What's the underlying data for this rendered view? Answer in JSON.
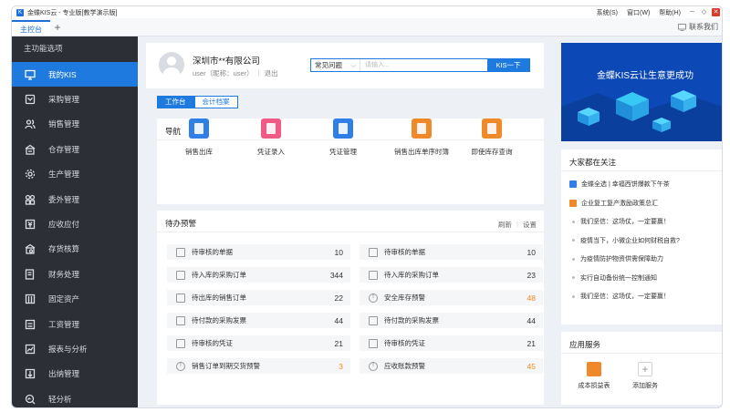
{
  "window": {
    "title": "金蝶KIS云 - 专业版[教学演示版]",
    "menu": [
      "系统(S)",
      "窗口(W)",
      "帮助(H)"
    ],
    "min": "－",
    "restore": "◇",
    "close": "✕"
  },
  "tabs": {
    "main": "主控台",
    "add": "+",
    "contact": "联系我们"
  },
  "sidebar": {
    "header": "主功能选项",
    "items": [
      {
        "label": "我的KIS",
        "icon": "monitor-icon"
      },
      {
        "label": "采购管理",
        "icon": "cart-icon"
      },
      {
        "label": "销售管理",
        "icon": "people-icon"
      },
      {
        "label": "仓存管理",
        "icon": "warehouse-icon"
      },
      {
        "label": "生产管理",
        "icon": "gear-icon"
      },
      {
        "label": "委外管理",
        "icon": "grid-icon"
      },
      {
        "label": "应收应付",
        "icon": "yuan-icon"
      },
      {
        "label": "存货核算",
        "icon": "inventory-icon"
      },
      {
        "label": "财务处理",
        "icon": "ledger-icon"
      },
      {
        "label": "固定资产",
        "icon": "asset-icon"
      },
      {
        "label": "工资管理",
        "icon": "payroll-icon"
      },
      {
        "label": "报表与分析",
        "icon": "chart-icon"
      },
      {
        "label": "出纳管理",
        "icon": "cash-icon"
      },
      {
        "label": "轻分析",
        "icon": "analysis-icon"
      }
    ]
  },
  "company": {
    "name": "深圳市**有限公司",
    "user": "user（昵称：user）",
    "logout": "退出"
  },
  "search": {
    "category": "常见问题",
    "placeholder": "请输入...",
    "button": "KIS一下"
  },
  "subtabs": [
    "工作台",
    "会计档案"
  ],
  "nav": {
    "title": "导航",
    "items": [
      {
        "label": "销售出库",
        "color": "#2f7fe6"
      },
      {
        "label": "凭证录入",
        "color": "#ef5b84"
      },
      {
        "label": "凭证管理",
        "color": "#2f7fe6"
      },
      {
        "label": "销售出库单序时簿",
        "color": "#f0892a"
      },
      {
        "label": "即使库存查询",
        "color": "#f0892a"
      }
    ]
  },
  "todo": {
    "title": "待办预警",
    "refresh": "刷新",
    "settings": "设置",
    "left": [
      {
        "label": "待审核的单据",
        "value": "10",
        "alert": false,
        "warn": false
      },
      {
        "label": "待入库的采购订单",
        "value": "344",
        "alert": false,
        "warn": false
      },
      {
        "label": "待出库的销售订单",
        "value": "22",
        "alert": false,
        "warn": false
      },
      {
        "label": "待付款的采购发票",
        "value": "44",
        "alert": false,
        "warn": false
      },
      {
        "label": "待审核的凭证",
        "value": "21",
        "alert": false,
        "warn": false
      },
      {
        "label": "销售订单到期交货预警",
        "value": "3",
        "alert": true,
        "warn": true
      }
    ],
    "right": [
      {
        "label": "待审核的单据",
        "value": "10",
        "alert": false,
        "warn": false
      },
      {
        "label": "待入库的采购订单",
        "value": "23",
        "alert": false,
        "warn": false
      },
      {
        "label": "安全库存预警",
        "value": "48",
        "alert": true,
        "warn": true
      },
      {
        "label": "待付款的采购发票",
        "value": "44",
        "alert": false,
        "warn": false
      },
      {
        "label": "待审核的凭证",
        "value": "21",
        "alert": false,
        "warn": false
      },
      {
        "label": "应收账款预警",
        "value": "45",
        "alert": true,
        "warn": true
      }
    ]
  },
  "banner": {
    "text": "金蝶KIS云让生意更成功"
  },
  "focus": {
    "title": "大家都在关注",
    "items": [
      {
        "text": "金蝶全选 | 幸福西饼爆款下午茶",
        "badge": "#2f7fe6"
      },
      {
        "text": "企业复工复产激励政策总汇",
        "badge": "#f0892a"
      },
      {
        "text": "我们坚信：这场仗，一定要赢！",
        "badge": ""
      },
      {
        "text": "疫情当下，小微企业如何财税自救?",
        "badge": ""
      },
      {
        "text": "为疫情防护物资供需保障助力",
        "badge": ""
      },
      {
        "text": "实行自动备份统一控制通知",
        "badge": ""
      },
      {
        "text": "我们坚信：这场仗，一定要赢！",
        "badge": ""
      }
    ]
  },
  "services": {
    "title": "应用服务",
    "items": [
      {
        "label": "成本损益表"
      },
      {
        "label": "添加服务"
      }
    ],
    "add_symbol": "+"
  },
  "colors": {
    "accent": "#1f7ae0",
    "sidebar_bg": "#2c2f36",
    "warn": "#f28a1e",
    "banner_bg": "#0d49b6"
  }
}
